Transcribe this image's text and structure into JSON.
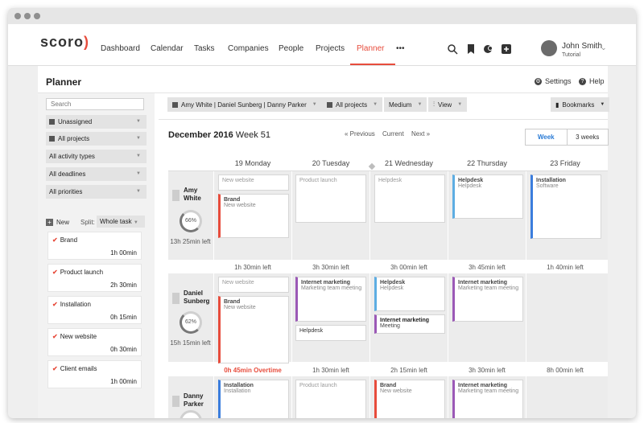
{
  "topnav": {
    "logo": "scoro",
    "items": [
      {
        "label": "Dashboard",
        "active": false
      },
      {
        "label": "Calendar",
        "active": false
      },
      {
        "label": "Tasks",
        "active": false
      },
      {
        "label": "Companies",
        "active": false
      },
      {
        "label": "People",
        "active": false
      },
      {
        "label": "Projects",
        "active": false
      },
      {
        "label": "Planner",
        "active": true
      },
      {
        "label": "•••",
        "active": false
      }
    ],
    "icons": [
      "search-icon",
      "bookmark-icon",
      "chat-icon",
      "add-icon"
    ],
    "user": {
      "name": "John Smith",
      "subtitle": "Tutorial"
    },
    "accent": "#e74c3c"
  },
  "header": {
    "title": "Planner",
    "settings_label": "Settings",
    "help_label": "Help"
  },
  "sidebar": {
    "search_placeholder": "Search",
    "filters": [
      {
        "label": "Unassigned",
        "icon": "user-icon"
      },
      {
        "label": "All projects",
        "icon": "briefcase-icon"
      },
      {
        "label": "All activity types",
        "icon": ""
      },
      {
        "label": "All deadlines",
        "icon": ""
      },
      {
        "label": "All priorities",
        "icon": ""
      }
    ],
    "new_label": "New",
    "split_label": "Split:",
    "split_value": "Whole task",
    "tasks": [
      {
        "name": "Brand",
        "time": "1h 00min"
      },
      {
        "name": "Product launch",
        "time": "2h 30min"
      },
      {
        "name": "Installation",
        "time": "0h 15min"
      },
      {
        "name": "New website",
        "time": "0h 30min"
      },
      {
        "name": "Client emails",
        "time": "1h 00min"
      }
    ]
  },
  "filterbar": {
    "people": "Amy White | Daniel Sunberg | Danny Parker",
    "projects": "All projects",
    "size": "Medium",
    "view": "View",
    "bookmarks": "Bookmarks"
  },
  "calendar": {
    "month": "December 2016",
    "week": "Week 51",
    "prev_label": "« Previous",
    "current_label": "Current",
    "next_label": "Next »",
    "view_week": "Week",
    "view_3weeks": "3 weeks",
    "days": [
      "19 Monday",
      "20 Tuesday",
      "21 Wednesday",
      "22 Thursday",
      "23 Friday"
    ],
    "people": [
      {
        "first": "Amy",
        "last": "White",
        "percent": "66%",
        "left": "13h 25min left",
        "day_left": [
          "1h 30min left",
          "3h 30min left",
          "3h 00min left",
          "3h 45min left",
          "1h 40min left"
        ],
        "cards": [
          {
            "day": 0,
            "title": "New website",
            "sub": "",
            "color": ""
          },
          {
            "day": 0,
            "title": "Brand",
            "sub": "New website",
            "color": "#e74c3c"
          },
          {
            "day": 1,
            "title": "Product launch",
            "sub": "",
            "color": ""
          },
          {
            "day": 2,
            "title": "Helpdesk",
            "sub": "",
            "color": ""
          },
          {
            "day": 3,
            "title": "Helpdesk",
            "sub": "Helpdesk",
            "color": "#5dade2"
          },
          {
            "day": 4,
            "title": "Installation",
            "sub": "Software",
            "color": "#3b7ddd"
          }
        ]
      },
      {
        "first": "Daniel",
        "last": "Sunberg",
        "percent": "62%",
        "left": "15h 15min left",
        "overtime": "0h 45min Overtime",
        "day_left": [
          "",
          "1h 30min left",
          "2h 15min left",
          "3h 30min left",
          "8h 00min left"
        ],
        "cards": [
          {
            "day": 0,
            "title": "New website",
            "sub": "",
            "color": ""
          },
          {
            "day": 0,
            "title": "Brand",
            "sub": "New website",
            "color": "#e74c3c"
          },
          {
            "day": 1,
            "title": "Internet marketing",
            "sub": "Marketing team meeting",
            "color": "#9b59b6"
          },
          {
            "day": 1,
            "title": "Helpdesk",
            "sub": "",
            "color": ""
          },
          {
            "day": 2,
            "title": "Helpdesk",
            "sub": "Helpdesk",
            "color": "#5dade2"
          },
          {
            "day": 2,
            "title": "Internet marketing",
            "sub": "Meeting",
            "color": "#9b59b6"
          },
          {
            "day": 3,
            "title": "Internet marketing",
            "sub": "Marketing team meeting",
            "color": "#9b59b6"
          }
        ]
      },
      {
        "first": "Danny",
        "last": "Parker",
        "percent": "",
        "left": "",
        "cards": [
          {
            "day": 0,
            "title": "Installation",
            "sub": "Installation",
            "color": "#3b7ddd"
          },
          {
            "day": 1,
            "title": "Product launch",
            "sub": "",
            "color": ""
          },
          {
            "day": 2,
            "title": "Brand",
            "sub": "New website",
            "color": "#e74c3c"
          },
          {
            "day": 3,
            "title": "Internet marketing",
            "sub": "Marketing team meeting",
            "color": "#9b59b6"
          }
        ]
      }
    ]
  }
}
